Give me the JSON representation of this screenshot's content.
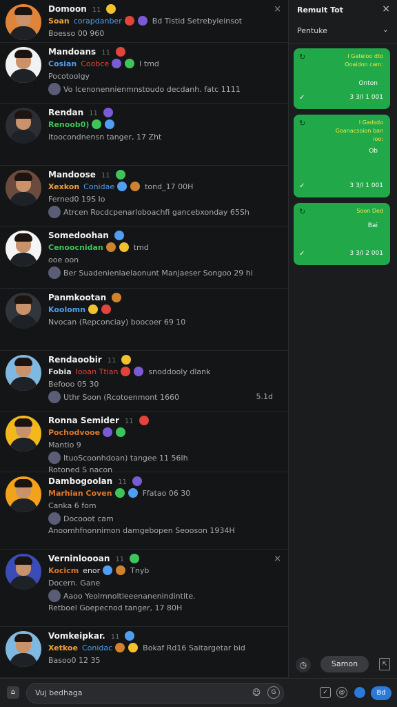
{
  "colors": {
    "background": "#141516",
    "panel": "#1b1c1e",
    "card_green": "#20a849",
    "accent_blue": "#2b79d8",
    "orange_text": "#e0782a",
    "blue_text": "#4f9ef2",
    "green_text": "#3ec45a",
    "red_text": "#e0443a"
  },
  "feed": [
    {
      "name": "Domoon",
      "time": "11",
      "line2": "Soan",
      "line2b": "corapdanber",
      "line2c": "Bd Tistid Setrebyleinsot",
      "line3": "Boesso 00 960",
      "line4": "",
      "dismiss": "×"
    },
    {
      "name": "Mandoans",
      "time": "11",
      "line2": "Cosian",
      "line2b": "Coobce",
      "line2c": "I tmd",
      "line3": "Pocotoolgy",
      "line4": "Vo Icenonennienmnstoudo decdanh. fatc 1111"
    },
    {
      "name": "Rendan",
      "time": "11",
      "line2": "Renoob0)",
      "line2b": "",
      "line2c": "",
      "line3": "Itoocondnensn tanger, 17 Zht",
      "line4": ""
    },
    {
      "name": "Mandoose",
      "time": "11",
      "line2": "Xexkon",
      "line2b": "Conidae",
      "line2c": "tond_17 00H",
      "line3": "Ferned0 19S Io",
      "line4": "Atrcen Rocdcpenarloboachfi gancebxonday 65Sh"
    },
    {
      "name": "Somedoohan",
      "time": "",
      "line2": "Cenoocnidan",
      "line2b": "",
      "line2c": "tmd",
      "line3": "ooe oon",
      "line4": "Ber Suadenienlaelaonunt Manjaeser Songoo 29 hi"
    },
    {
      "name": "Panmkootan",
      "time": "",
      "line2": "Koolomn",
      "line2b": "",
      "line2c": "",
      "line3": "Nvocan (Repconciay) boocoer 69 10",
      "line4": ""
    },
    {
      "name": "Rendaoobir",
      "time": "11",
      "line2": "Fobia",
      "line2b": "Iooan Ttian",
      "line2c": "snoddooly dlank",
      "line3": "Befooo 05 30",
      "line4": "Uthr Soon (Rcotoenmont 1660",
      "dur": "5.1d"
    },
    {
      "name": "Ronna Semider",
      "time": "11",
      "line2": "Pochodvooe",
      "line2b": "",
      "line2c": "",
      "line3": "Mantio 9",
      "line4": "ItuoScoonhdoan) tangee 11 56Ih",
      "line5": "Rotoned S nacon"
    },
    {
      "name": "Dambogoolan",
      "time": "11",
      "line2": "Marhian Coven",
      "line2b": "",
      "line2c": "Ffatao 06 30",
      "line3": "Canka 6 fom",
      "line4": "Docooot cam",
      "line5": "Anoomhfnonnimon damgebopen Seooson 1934H"
    },
    {
      "name": "Verninloooan",
      "time": "11",
      "line2": "Kocicm",
      "line2b": "enor",
      "line2c": "Tnyb",
      "line3": "Docern. Gane",
      "line4": "Aaoo Yeolmnoltleeenanenindintite.",
      "line5": "Retboel Goepecnod tanger, 17 80H",
      "dismiss": "×"
    },
    {
      "name": "Vomkeipkar.",
      "time": "11",
      "line2": "Xetkoe",
      "line2b": "Conidac",
      "line2c": "Bokaf Rd16 Saitargetar bid",
      "line3": "Basoo0 12 35",
      "line4": ""
    }
  ],
  "panel": {
    "title": "Remult Tot",
    "close": "×",
    "filter": "Pentuke",
    "cards": [
      {
        "text": "I Gateloo dto Ooaidon cam:",
        "mid": "Onton",
        "date": "3 3/I 1 001"
      },
      {
        "text": "I Gadsdo Goanacsoion ban loo:",
        "mid": "Ob",
        "date": "3 3/I 1 001"
      },
      {
        "text": "Soon Ded",
        "mid": "Bai",
        "date": "3 3/I 2 001"
      }
    ],
    "bottom_button": "Samon"
  },
  "composer": {
    "placeholder": "Vuj bedhaga",
    "send": "Bd"
  }
}
